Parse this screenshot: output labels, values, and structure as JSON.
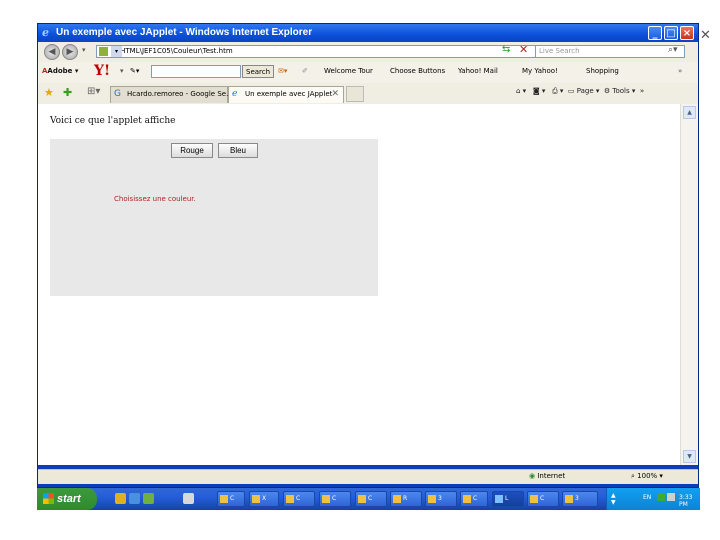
{
  "window": {
    "title": "Un exemple avec JApplet - Windows Internet Explorer",
    "min_label": "_",
    "max_label": "□",
    "close_label": "×"
  },
  "addressbar": {
    "url": "E:\\HTML\\JEF1C05\\Couleur\\Test.htm",
    "search_placeholder": "Live Search"
  },
  "toolbar": {
    "adobe": "Adobe",
    "yahoo": "Y!",
    "search_button": "Search",
    "items": [
      "Welcome Tour",
      "Choose Buttons",
      "Yahoo! Mail",
      "My Yahoo!",
      "Shopping"
    ]
  },
  "tabs": [
    {
      "label": "Hcardo.remoreo - Google Se..."
    },
    {
      "label": "Un exemple avec JApplet"
    }
  ],
  "commandbar": {
    "page": "Page",
    "tools": "Tools"
  },
  "page": {
    "intro_text": "Voici ce que l'applet affiche",
    "applet": {
      "buttons": [
        "Rouge",
        "Bleu"
      ],
      "message": "Choisissez une couleur."
    }
  },
  "statusbar": {
    "zone": "Internet",
    "zoom": "100%"
  },
  "taskbar": {
    "start": "start",
    "lang": "EN",
    "time": "3:33 PM",
    "tasks": [
      "C",
      "X",
      "C",
      "C",
      "C",
      "R",
      "3",
      "C",
      "L",
      "C",
      "3"
    ]
  }
}
